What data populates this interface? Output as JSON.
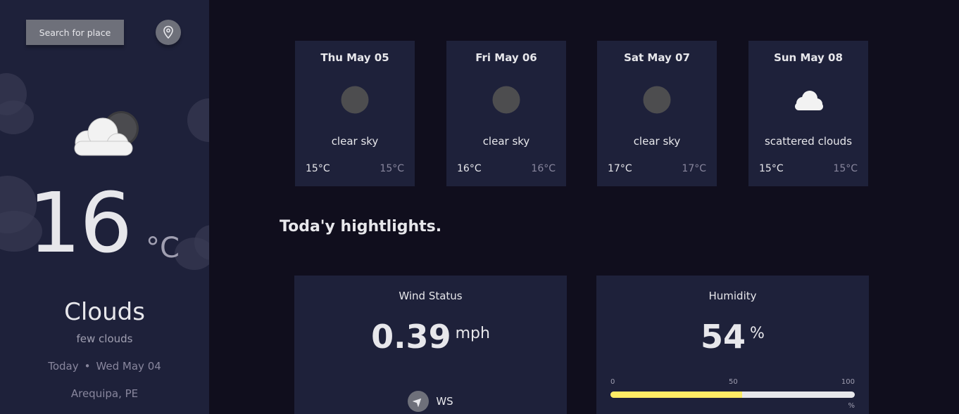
{
  "sidebar": {
    "search_label": "Search for place",
    "icons": {
      "location": "location-pin-icon",
      "weather": "cloud-sun-icon"
    },
    "temperature": "16",
    "temperature_unit": "°C",
    "weather_main": "Clouds",
    "weather_description": "few clouds",
    "today_label": "Today",
    "separator": "•",
    "date": "Wed May 04",
    "location": "Arequipa, PE"
  },
  "forecast": [
    {
      "day": "Thu May 05",
      "icon": "clear-sky-icon",
      "description": "clear sky",
      "max": "15°C",
      "min": "15°C"
    },
    {
      "day": "Fri May 06",
      "icon": "clear-sky-icon",
      "description": "clear sky",
      "max": "16°C",
      "min": "16°C"
    },
    {
      "day": "Sat May 07",
      "icon": "clear-sky-icon",
      "description": "clear sky",
      "max": "17°C",
      "min": "17°C"
    },
    {
      "day": "Sun May 08",
      "icon": "scattered-clouds-icon",
      "description": "scattered clouds",
      "max": "15°C",
      "min": "15°C"
    }
  ],
  "highlights": {
    "title": "Toda'y hightlights.",
    "wind": {
      "title": "Wind Status",
      "value": "0.39",
      "unit": "mph",
      "direction": "WS",
      "icon": "navigation-arrow-icon"
    },
    "humidity": {
      "title": "Humidity",
      "value": "54",
      "unit": "%",
      "scale_min": "0",
      "scale_mid": "50",
      "scale_max": "100",
      "scale_unit": "%",
      "level_percent": 54
    }
  },
  "colors": {
    "background": "#100e1d",
    "panel": "#1e213a",
    "text": "#e7e7eb",
    "muted": "#a09fb1",
    "button": "#6e707a",
    "humidity_fill": "#ffec65"
  }
}
